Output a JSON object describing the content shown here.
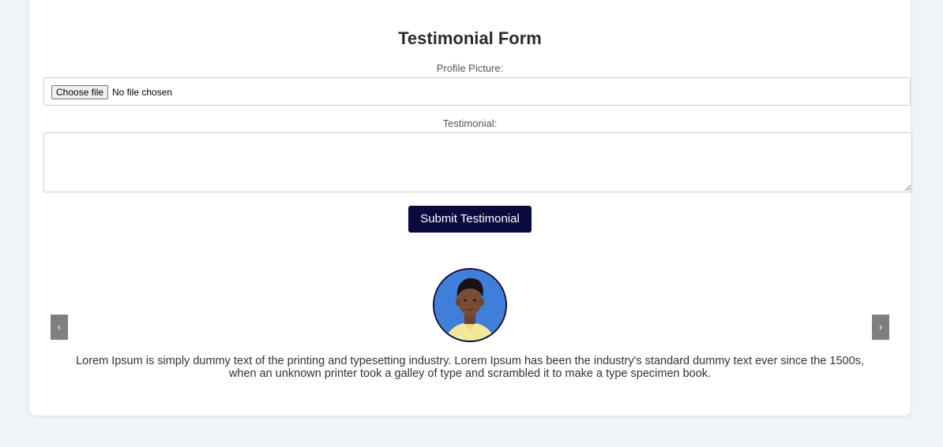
{
  "form": {
    "title": "Testimonial Form",
    "profile_label": "Profile Picture:",
    "file_button": "Choose file",
    "file_status": "No file chosen",
    "testimonial_label": "Testimonial:",
    "testimonial_value": "",
    "submit_label": "Submit Testimonial"
  },
  "carousel": {
    "prev_label": "‹",
    "next_label": "›",
    "text": "Lorem Ipsum is simply dummy text of the printing and typesetting industry. Lorem Ipsum has been the industry's standard dummy text ever since the 1500s, when an unknown printer took a galley of type and scrambled it to make a type specimen book."
  },
  "colors": {
    "background": "#f0f3f7",
    "button": "#0b0a40",
    "arrow": "#7f7f7f",
    "avatar_bg": "#3f7fd9"
  }
}
